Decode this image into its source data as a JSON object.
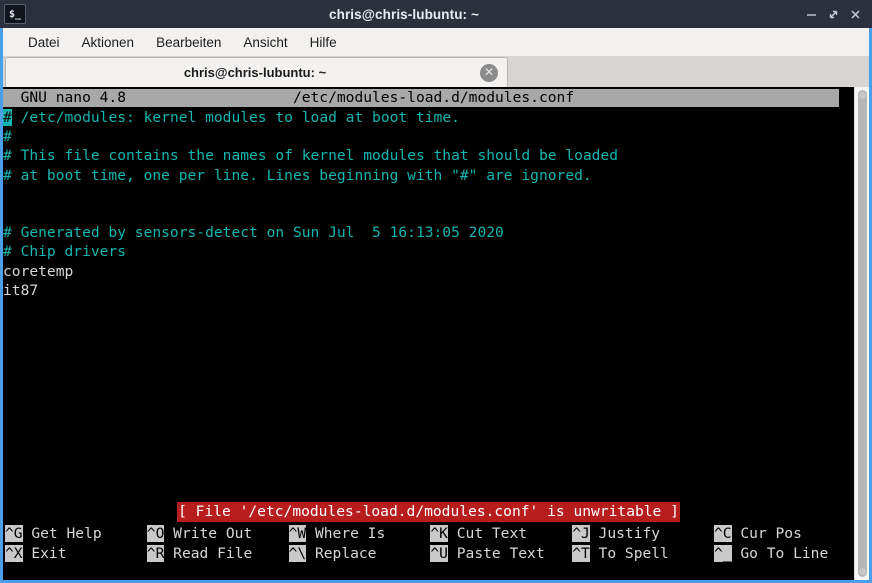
{
  "window": {
    "title": "chris@chris-lubuntu: ~",
    "icon": "terminal-icon",
    "icon_glyph": "$_",
    "minimize_label": "–",
    "maximize_label": "⤡",
    "close_label": "✕",
    "border_color": "#4a9fe8",
    "titlebar_color": "#2b303b"
  },
  "menubar": {
    "items": [
      {
        "label": "Datei"
      },
      {
        "label": "Aktionen"
      },
      {
        "label": "Bearbeiten"
      },
      {
        "label": "Ansicht"
      },
      {
        "label": "Hilfe"
      }
    ]
  },
  "tabbar": {
    "tabs": [
      {
        "label": "chris@chris-lubuntu: ~",
        "close_glyph": "✕",
        "active": true
      }
    ]
  },
  "terminal": {
    "background": "#000000",
    "comment_color": "#12b6b0",
    "text_color": "#d6d6d6",
    "nano": {
      "title_left": "GNU nano 4.8",
      "title_center": "/etc/modules-load.d/modules.conf",
      "title_line": "  GNU nano 4.8                   /etc/modules-load.d/modules.conf",
      "cursor_char": "#",
      "lines": [
        {
          "text": "# /etc/modules: kernel modules to load at boot time.",
          "style": "comment",
          "cursor": true
        },
        {
          "text": "#",
          "style": "comment"
        },
        {
          "text": "# This file contains the names of kernel modules that should be loaded",
          "style": "comment"
        },
        {
          "text": "# at boot time, one per line. Lines beginning with \"#\" are ignored.",
          "style": "comment"
        },
        {
          "text": "",
          "style": "plain"
        },
        {
          "text": "",
          "style": "plain"
        },
        {
          "text": "# Generated by sensors-detect on Sun Jul  5 16:13:05 2020",
          "style": "comment"
        },
        {
          "text": "# Chip drivers",
          "style": "comment"
        },
        {
          "text": "coretemp",
          "style": "plain"
        },
        {
          "text": "it87",
          "style": "plain"
        }
      ],
      "status_message": "[ File '/etc/modules-load.d/modules.conf' is unwritable ]",
      "status_bg": "#b81d1d",
      "status_fg": "#ffffff",
      "shortcuts_row1": [
        {
          "key": "^G",
          "label": "Get Help"
        },
        {
          "key": "^O",
          "label": "Write Out"
        },
        {
          "key": "^W",
          "label": "Where Is"
        },
        {
          "key": "^K",
          "label": "Cut Text"
        },
        {
          "key": "^J",
          "label": "Justify"
        },
        {
          "key": "^C",
          "label": "Cur Pos"
        }
      ],
      "shortcuts_row2": [
        {
          "key": "^X",
          "label": "Exit"
        },
        {
          "key": "^R",
          "label": "Read File"
        },
        {
          "key": "^\\",
          "label": "Replace"
        },
        {
          "key": "^U",
          "label": "Paste Text"
        },
        {
          "key": "^T",
          "label": "To Spell"
        },
        {
          "key": "^_",
          "label": "Go To Line"
        }
      ]
    }
  },
  "scrollbar": {
    "orientation": "vertical",
    "thumb_color": "#b6b6b6"
  }
}
